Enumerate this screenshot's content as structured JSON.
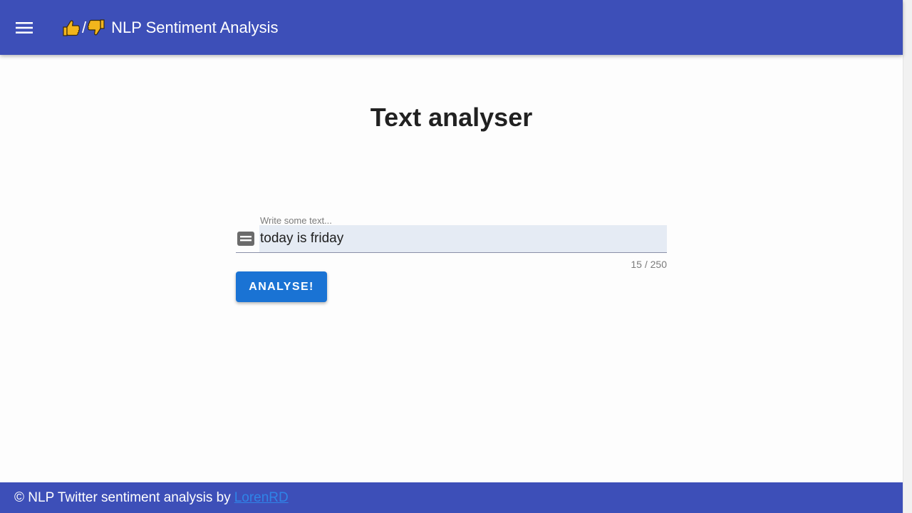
{
  "header": {
    "menu_icon": "hamburger-menu-icon",
    "thumbs_up_icon": "thumbs-up-icon",
    "separator": "/",
    "thumbs_down_icon": "thumbs-down-icon",
    "title": "NLP Sentiment Analysis",
    "background_color": "#3d4fb8"
  },
  "main": {
    "heading": "Text analyser",
    "text_field": {
      "label": "Write some text...",
      "value": "today is friday",
      "icon": "text-box-icon",
      "counter": "15 / 250"
    },
    "analyse_button": {
      "label": "ANALYSE!",
      "color": "#1a73d4"
    }
  },
  "footer": {
    "text": "© NLP Twitter sentiment analysis by",
    "link_text": "LorenRD",
    "link_color": "#2f84e8"
  }
}
